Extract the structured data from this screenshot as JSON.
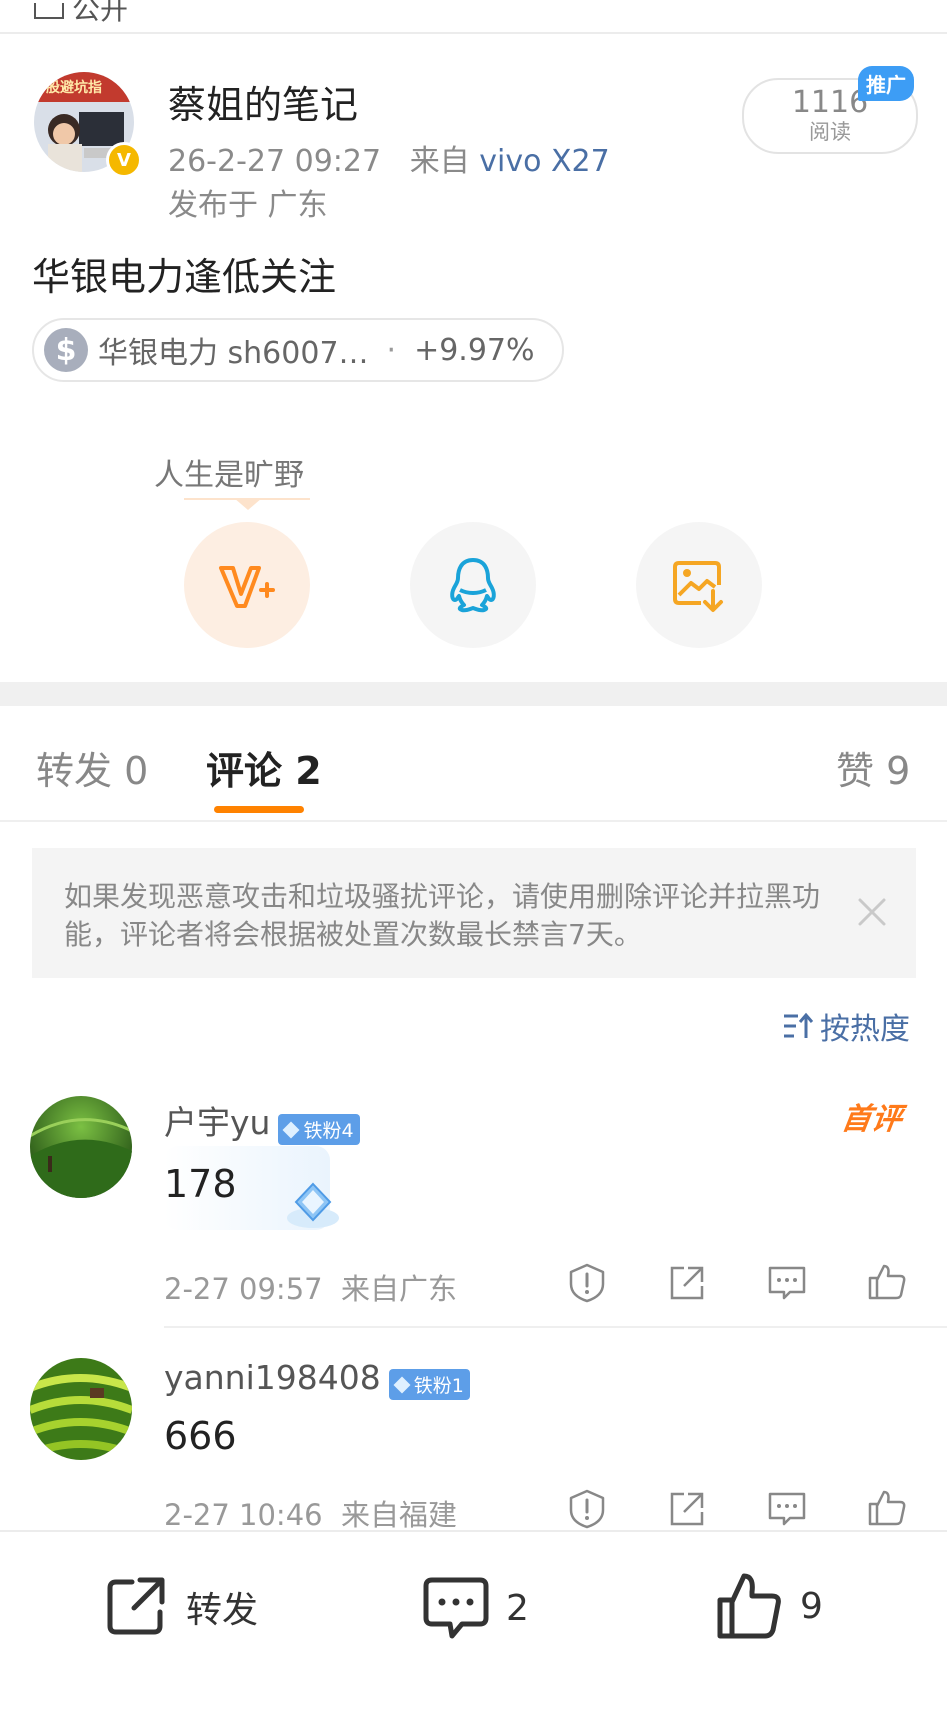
{
  "topbar": {
    "partial_label": "公开"
  },
  "post": {
    "author": "蔡姐的笔记",
    "time": "26-2-27 09:27",
    "from_label": "来自",
    "source": "vivo X27",
    "location": "发布于 广东",
    "text": "华银电力逢低关注",
    "read_count": "1116",
    "read_label": "阅读",
    "promo_badge": "推广",
    "avatar_badge": "V",
    "stock": {
      "name": "华银电力 sh6007…",
      "separator": "·",
      "change": "+9.97%",
      "icon": "$"
    }
  },
  "share": {
    "title": "人生是旷野",
    "buttons": [
      {
        "icon": "weibo-vplus-icon"
      },
      {
        "icon": "qq-icon"
      },
      {
        "icon": "save-image-icon"
      }
    ]
  },
  "tabs": {
    "repost": {
      "label": "转发",
      "count": "0"
    },
    "comment": {
      "label": "评论",
      "count": "2"
    },
    "like": {
      "label": "赞",
      "count": "9"
    }
  },
  "notice": {
    "text": "如果发现恶意攻击和垃圾骚扰评论，请使用删除评论并拉黑功能，评论者将会根据被处置次数最长禁言7天。"
  },
  "sort": {
    "label": "按热度"
  },
  "comments": [
    {
      "user": "户宇yu",
      "fan_badge": "铁粉4",
      "text": "178",
      "time": "2-27 09:57",
      "location": "来自广东",
      "tag": "首评"
    },
    {
      "user": "yanni198408",
      "fan_badge": "铁粉1",
      "text": "666",
      "time": "2-27 10:46",
      "location": "来自福建"
    }
  ],
  "bottom": {
    "repost_label": "转发",
    "comment_count": "2",
    "like_count": "9"
  },
  "colors": {
    "accent": "#ff8200",
    "link": "#4a6fa5",
    "badge": "#5d9ee8",
    "promo": "#3d9df5"
  }
}
